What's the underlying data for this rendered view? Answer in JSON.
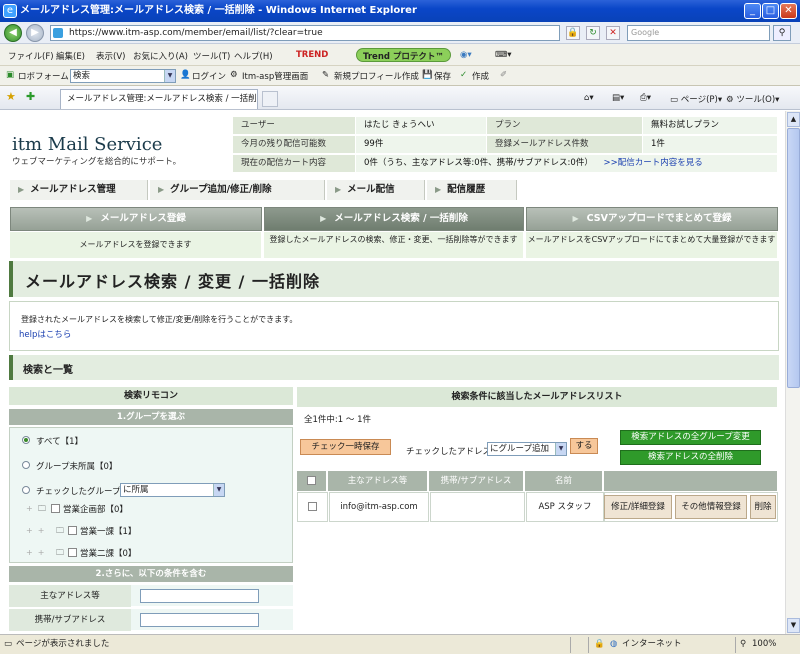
{
  "window": {
    "title": "メールアドレス管理:メールアドレス検索 / 一括削除 - Windows Internet Explorer",
    "url": "https://www.itm-asp.com/member/email/list/?clear=true",
    "search_placeholder": "Google"
  },
  "menu": [
    "ファイル(F)",
    "編集(E)",
    "表示(V)",
    "お気に入り(A)",
    "ツール(T)",
    "ヘルプ(H)"
  ],
  "toolbar": {
    "trend": "TREND",
    "trend_protect": "Trend プロテクト™"
  },
  "links_bar": {
    "roboform": "ロボフォーム",
    "search_label": "検索",
    "login": "ログイン",
    "itm_admin": "Itm-asp管理画面",
    "new_profile": "新規プロフィール作成",
    "save": "保存",
    "create": "作成"
  },
  "tab": {
    "label": "メールアドレス管理:メールアドレス検索 / 一括削除"
  },
  "tools": {
    "page": "ページ(P)",
    "tools": "ツール(O)"
  },
  "status": {
    "text": "ページが表示されました",
    "zone": "インターネット",
    "zoom": "100%"
  },
  "site": {
    "logo": "itm Mail Service",
    "tagline": "ウェブマーケティングを総合的にサポート。"
  },
  "info": {
    "user_label": "ユーザー",
    "user_value": "はたじ きょうへい",
    "plan_label": "プラン",
    "plan_value": "無料お試しプラン",
    "remaining_label": "今月の残り配信可能数",
    "remaining_value": "99件",
    "registered_label": "登録メールアドレス件数",
    "registered_value": "1件",
    "cart_label": "現在の配信カート内容",
    "cart_value": "0件（うち、主なアドレス等:0件、携帯/サブアドレス:0件）",
    "cart_link": ">>配信カート内容を見る"
  },
  "mainnav": [
    "メールアドレス管理",
    "グループ追加/修正/削除",
    "メール配信",
    "配信履歴"
  ],
  "bigtabs": [
    {
      "label": "メールアドレス登録",
      "desc": "メールアドレスを登録できます"
    },
    {
      "label": "メールアドレス検索 / 一括削除",
      "desc": "登録したメールアドレスの検索、修正・変更、一括削除等ができます"
    },
    {
      "label": "CSVアップロードでまとめて登録",
      "desc": "メールアドレスをCSVアップロードにてまとめて大量登録ができます"
    }
  ],
  "page": {
    "title": "メールアドレス検索 / 変更 / 一括削除",
    "description": "登録されたメールアドレスを検索して修正/変更/削除を行うことができます。",
    "help_link": "helpはこちら",
    "section": "検索と一覧"
  },
  "remote": {
    "heading": "検索リモコン",
    "step1": "1.グループを選ぶ",
    "opt_all": "すべて【1】",
    "opt_unassigned": "グループ未所属【0】",
    "opt_checked": "チェックしたグループ",
    "opt_checked_select": "に所属",
    "tree": [
      "営業企画部【0】",
      "営業一課【1】",
      "営業二課【0】"
    ],
    "step2": "2.さらに、以下の条件を含む",
    "fields": [
      "主なアドレス等",
      "携帯/サブアドレス"
    ]
  },
  "results": {
    "heading": "検索条件に該当したメールアドレスリスト",
    "count": "全1件中:1 ～ 1件",
    "temp_save": "チェック一時保存",
    "checked_label": "チェックしたアドレス",
    "group_select": "にグループ追加",
    "do_button": "する",
    "change_all_groups": "検索アドレスの全グループ変更",
    "delete_all": "検索アドレスの全削除",
    "columns": [
      "主なアドレス等",
      "携帯/サブアドレス",
      "名前"
    ],
    "rows": [
      {
        "email": "info@itm-asp.com",
        "sub": "",
        "name": "ASP スタッフ"
      }
    ],
    "actions": [
      "修正/詳細登録",
      "その他情報登録",
      "削除"
    ]
  },
  "colors": {
    "accent_green": "#4f7a40",
    "button_green": "#2f9a2a",
    "button_orange": "#f7c79a"
  }
}
